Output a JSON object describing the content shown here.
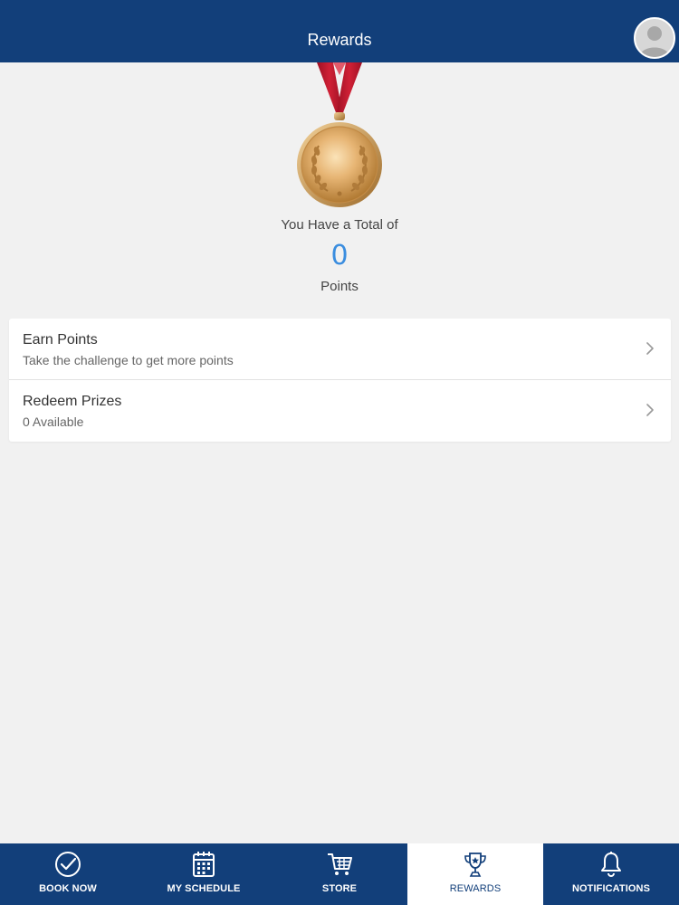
{
  "header": {
    "title": "Rewards"
  },
  "rewards": {
    "caption": "You Have a Total of",
    "points": "0",
    "unit": "Points"
  },
  "menu": {
    "earn": {
      "title": "Earn Points",
      "subtitle": "Take the challenge to get more points"
    },
    "redeem": {
      "title": "Redeem Prizes",
      "subtitle": "0 Available"
    }
  },
  "tabs": [
    {
      "label": "BOOK NOW",
      "icon": "check-circle-icon",
      "active": false
    },
    {
      "label": "MY SCHEDULE",
      "icon": "calendar-icon",
      "active": false
    },
    {
      "label": "STORE",
      "icon": "cart-icon",
      "active": false
    },
    {
      "label": "REWARDS",
      "icon": "trophy-icon",
      "active": true
    },
    {
      "label": "NOTIFICATIONS",
      "icon": "bell-icon",
      "active": false
    }
  ],
  "colors": {
    "brand": "#123f7a",
    "accent": "#3a8ddf",
    "background": "#f1f1f1",
    "medal_ribbon": "#c0192e",
    "medal_gold": "#d9a45a"
  }
}
